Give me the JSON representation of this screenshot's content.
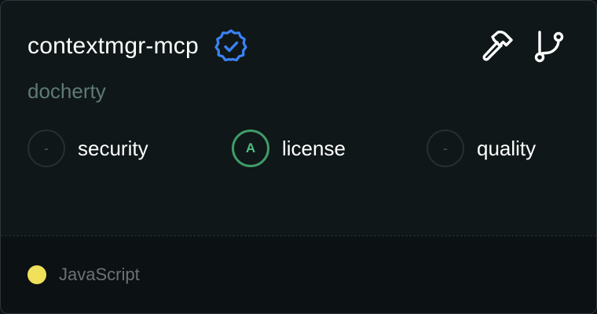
{
  "repo": {
    "name": "contextmgr-mcp",
    "author": "docherty",
    "verified_icon": "verified-badge-icon"
  },
  "actions": [
    {
      "icon": "hammer-icon"
    },
    {
      "icon": "git-fork-icon"
    }
  ],
  "scores": [
    {
      "label": "security",
      "grade": "-"
    },
    {
      "label": "license",
      "grade": "A"
    },
    {
      "label": "quality",
      "grade": "-"
    }
  ],
  "footer": {
    "language": "JavaScript",
    "language_color": "#f1e05a"
  },
  "colors": {
    "verified_blue": "#3b82f6",
    "grade_a_green": "#3f9b6a"
  }
}
